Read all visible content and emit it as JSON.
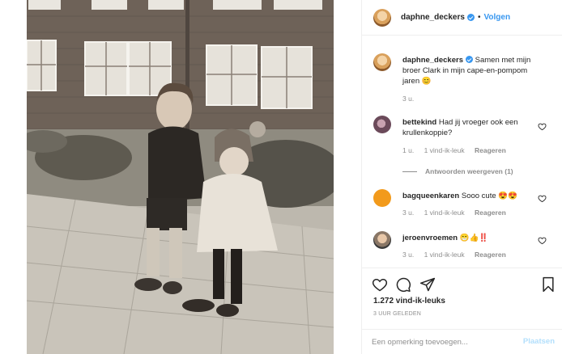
{
  "post": {
    "username": "daphne_deckers",
    "follow_label": "Volgen",
    "separator": "•",
    "photo_alt": "Zwart-wit foto van twee kinderen"
  },
  "caption": {
    "username": "daphne_deckers",
    "text": "Samen met mijn broer Clark in mijn cape-en-pompom jaren 😊",
    "time": "3 u."
  },
  "comments": [
    {
      "username": "bettekind",
      "text": "Had jij vroeger ook een krullenkoppie?",
      "time": "1 u.",
      "likes": "1 vind-ik-leuk",
      "reply": "Reageren",
      "view_replies": "Antwoorden weergeven (1)"
    },
    {
      "username": "bagqueenkaren",
      "text": "Sooo cute 😍😍",
      "time": "3 u.",
      "likes": "1 vind-ik-leuk",
      "reply": "Reageren"
    },
    {
      "username": "jeroenvroemen",
      "text": "😁👍‼️",
      "time": "3 u.",
      "likes": "1 vind-ik-leuk",
      "reply": "Reageren"
    }
  ],
  "footer": {
    "likes": "1.272 vind-ik-leuks",
    "posted_ago": "3 UUR GELEDEN",
    "comment_placeholder": "Een opmerking toevoegen...",
    "post_label": "Plaatsen"
  },
  "icons": {
    "like": "heart-icon",
    "comment": "comment-icon",
    "share": "share-icon",
    "save": "bookmark-icon"
  },
  "colors": {
    "link_blue": "#3897f0",
    "post_disabled": "#b2dffc",
    "muted": "#8e8e8e"
  }
}
